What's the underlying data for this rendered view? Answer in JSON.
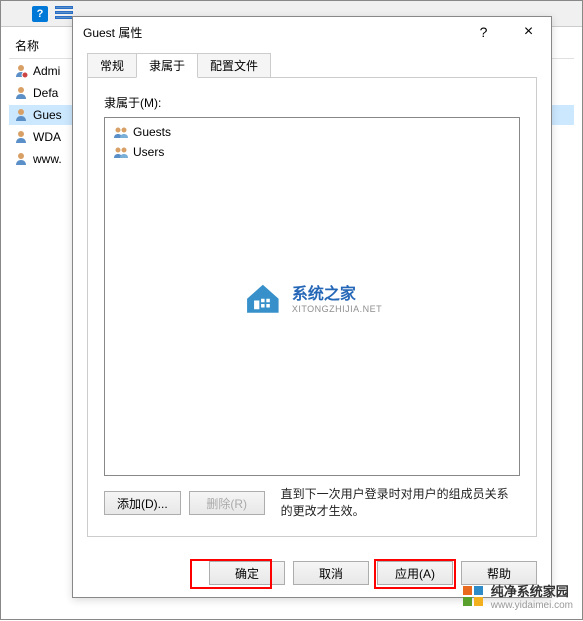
{
  "main_window": {
    "list_header": "名称",
    "items": [
      {
        "label": "Admi"
      },
      {
        "label": "Defa"
      },
      {
        "label": "Gues",
        "selected": true
      },
      {
        "label": "WDA"
      },
      {
        "label": "www."
      }
    ]
  },
  "dialog": {
    "title": "Guest 属性",
    "help_symbol": "?",
    "close_symbol": "×",
    "tabs": [
      {
        "label": "常规",
        "active": false
      },
      {
        "label": "隶属于",
        "active": true
      },
      {
        "label": "配置文件",
        "active": false
      }
    ],
    "panel": {
      "field_label": "隶属于(M):",
      "members": [
        {
          "name": "Guests"
        },
        {
          "name": "Users"
        }
      ],
      "add_button": "添加(D)...",
      "remove_button": "删除(R)",
      "hint": "直到下一次用户登录时对用户的组成员关系的更改才生效。"
    },
    "footer": {
      "ok": "确定",
      "cancel": "取消",
      "apply": "应用(A)",
      "help": "帮助"
    }
  },
  "watermark_center": {
    "title": "系统之家",
    "subtitle": "XITONGZHIJIA.NET"
  },
  "watermark_footer": {
    "title": "纯净系统家园",
    "subtitle": "www.yidaimei.com"
  }
}
